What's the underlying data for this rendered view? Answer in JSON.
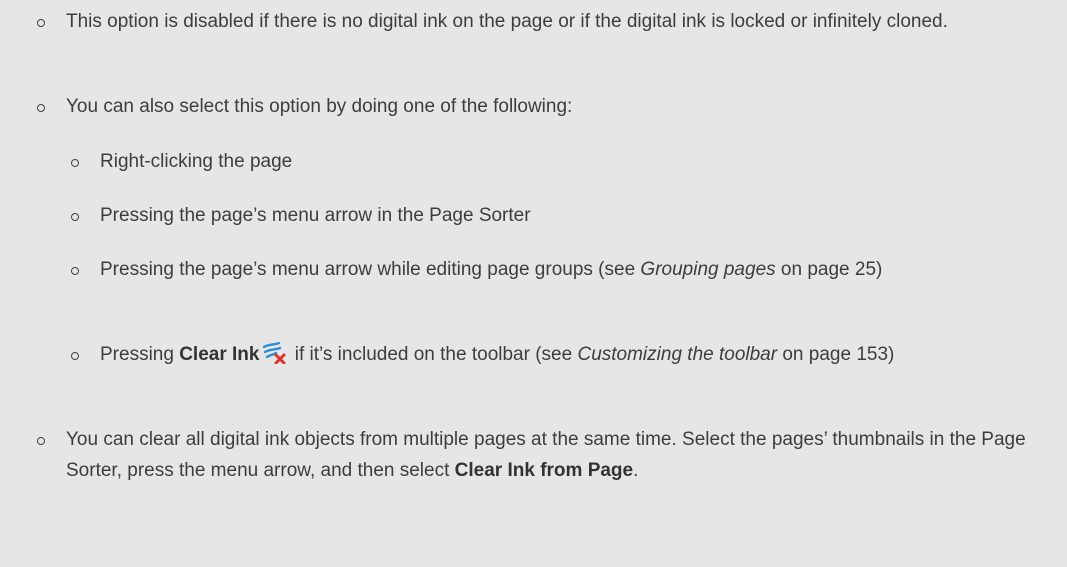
{
  "bullets": {
    "b1": {
      "text": "This option is disabled if there is no digital ink on the page or if the digital ink is locked or infinitely cloned."
    },
    "b2": {
      "text": "You can also select this option by doing one of the following:",
      "subitems": [
        {
          "text": "Right-clicking the page"
        },
        {
          "text": "Pressing the page’s menu arrow in the Page Sorter"
        },
        {
          "pre": "Pressing the page’s menu arrow while editing page groups (see ",
          "ref": "Grouping pages",
          "post": " on page 25)"
        },
        {
          "pre": "Pressing ",
          "bold": "Clear Ink",
          "icon": "clear-ink-icon",
          "mid": " if it’s included on the toolbar (see ",
          "ref": "Customizing the toolbar",
          "post": " on page 153)"
        }
      ]
    },
    "b3": {
      "pre": "You can clear all digital ink objects from multiple pages at the same time. Select the pages’ thumbnails in the Page Sorter, press the menu arrow, and then select ",
      "bold": "Clear Ink from Page",
      "post": "."
    }
  },
  "colors": {
    "background": "#e6e6e6",
    "text": "#3d3d3d",
    "icon_blue": "#2b8fd6",
    "icon_red": "#e0322b"
  }
}
